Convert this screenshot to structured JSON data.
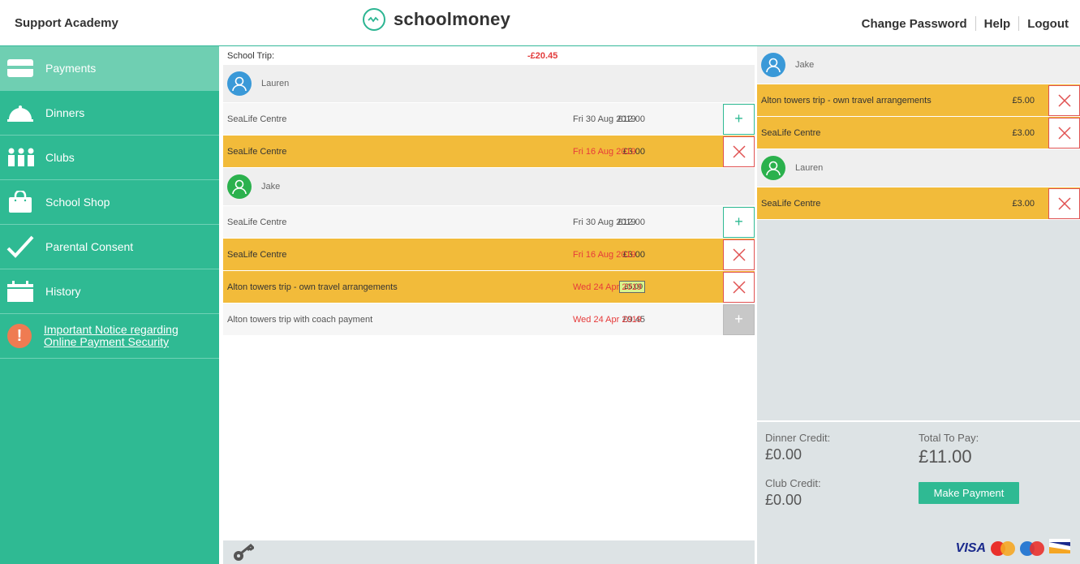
{
  "header": {
    "school_name": "Support Academy",
    "logo_text": "schoolmoney",
    "links": [
      "Change Password",
      "Help",
      "Logout"
    ]
  },
  "sidebar": {
    "items": [
      {
        "label": "Payments",
        "icon": "card-icon",
        "active": true
      },
      {
        "label": "Dinners",
        "icon": "cloche-icon",
        "active": false
      },
      {
        "label": "Clubs",
        "icon": "people-icon",
        "active": false
      },
      {
        "label": "School Shop",
        "icon": "shopping-bag-icon",
        "active": false
      },
      {
        "label": "Parental Consent",
        "icon": "checkmark-icon",
        "active": false
      },
      {
        "label": "History",
        "icon": "calendar-icon",
        "active": false
      }
    ],
    "notice": {
      "line1": "Important Notice regarding",
      "line2": "Online Payment Security"
    }
  },
  "main": {
    "summary_label": "School Trip:",
    "summary_amount": "-£20.45",
    "children": [
      {
        "name": "Lauren",
        "rows": [
          {
            "name": "SeaLife Centre",
            "price": "£12.00",
            "date": "Fri 30 Aug 2019"
          },
          {
            "name": "SeaLife Centre",
            "price": "£3.00",
            "date": "Fri 16 Aug 2019"
          }
        ]
      },
      {
        "name": "Jake",
        "rows": [
          {
            "name": "SeaLife Centre",
            "price": "£12.00",
            "date": "Fri 30 Aug 2019"
          },
          {
            "name": "SeaLife Centre",
            "price": "£3.00",
            "date": "Fri 16 Aug 2019"
          },
          {
            "name": "Alton towers trip - own travel arrangements",
            "price": "£5.00",
            "date": "Wed 24 Apr 2019"
          },
          {
            "name": "Alton towers trip with coach payment",
            "price": "£9.45",
            "date": "Wed 24 Apr 2019"
          }
        ]
      }
    ]
  },
  "basket": {
    "children": [
      {
        "name": "Jake",
        "rows": [
          {
            "name": "Alton towers trip - own travel arrangements",
            "price": "£5.00"
          },
          {
            "name": "SeaLife Centre",
            "price": "£3.00"
          }
        ]
      },
      {
        "name": "Lauren",
        "rows": [
          {
            "name": "SeaLife Centre",
            "price": "£3.00"
          }
        ]
      }
    ],
    "dinner_credit_label": "Dinner Credit:",
    "dinner_credit_value": "£0.00",
    "club_credit_label": "Club Credit:",
    "club_credit_value": "£0.00",
    "total_label": "Total To Pay:",
    "total_value": "£11.00",
    "pay_button": "Make Payment",
    "card_visa": "VISA",
    "card_brands": [
      "visa-logo-icon",
      "mastercard-logo-icon",
      "maestro-logo-icon",
      "visa-electron-logo-icon"
    ]
  },
  "colors": {
    "accent": "#2fba93",
    "selected_row": "#f2bb3a",
    "alert_red": "#e63a3a",
    "basket_bg": "#dde3e5"
  }
}
